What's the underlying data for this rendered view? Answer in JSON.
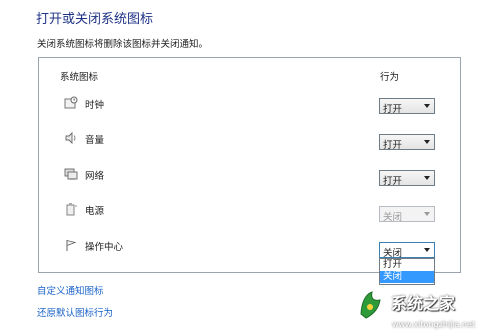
{
  "header": {
    "title": "打开或关闭系统图标",
    "description": "关闭系统图标将删除该图标并关闭通知。"
  },
  "table": {
    "col_icon": "系统图标",
    "col_behavior": "行为",
    "rows": [
      {
        "label": "时钟",
        "icon": "clock-icon",
        "value": "打开",
        "state": "enabled"
      },
      {
        "label": "音量",
        "icon": "volume-icon",
        "value": "打开",
        "state": "enabled"
      },
      {
        "label": "网络",
        "icon": "network-icon",
        "value": "打开",
        "state": "enabled"
      },
      {
        "label": "电源",
        "icon": "power-icon",
        "value": "关闭",
        "state": "disabled"
      },
      {
        "label": "操作中心",
        "icon": "action-center-flag-icon",
        "value": "关闭",
        "state": "open"
      }
    ],
    "dropdown_options": [
      "打开",
      "关闭"
    ],
    "highlighted_option": "关闭"
  },
  "links": {
    "customize": "自定义通知图标",
    "restore": "还原默认图标行为"
  },
  "watermark": {
    "brand": "系统之家",
    "url": "www.xitongzhijia.net"
  },
  "colors": {
    "title": "#1e3287",
    "link": "#1a63c9",
    "selection": "#3399ff",
    "panel_border": "#9aa3ad"
  }
}
